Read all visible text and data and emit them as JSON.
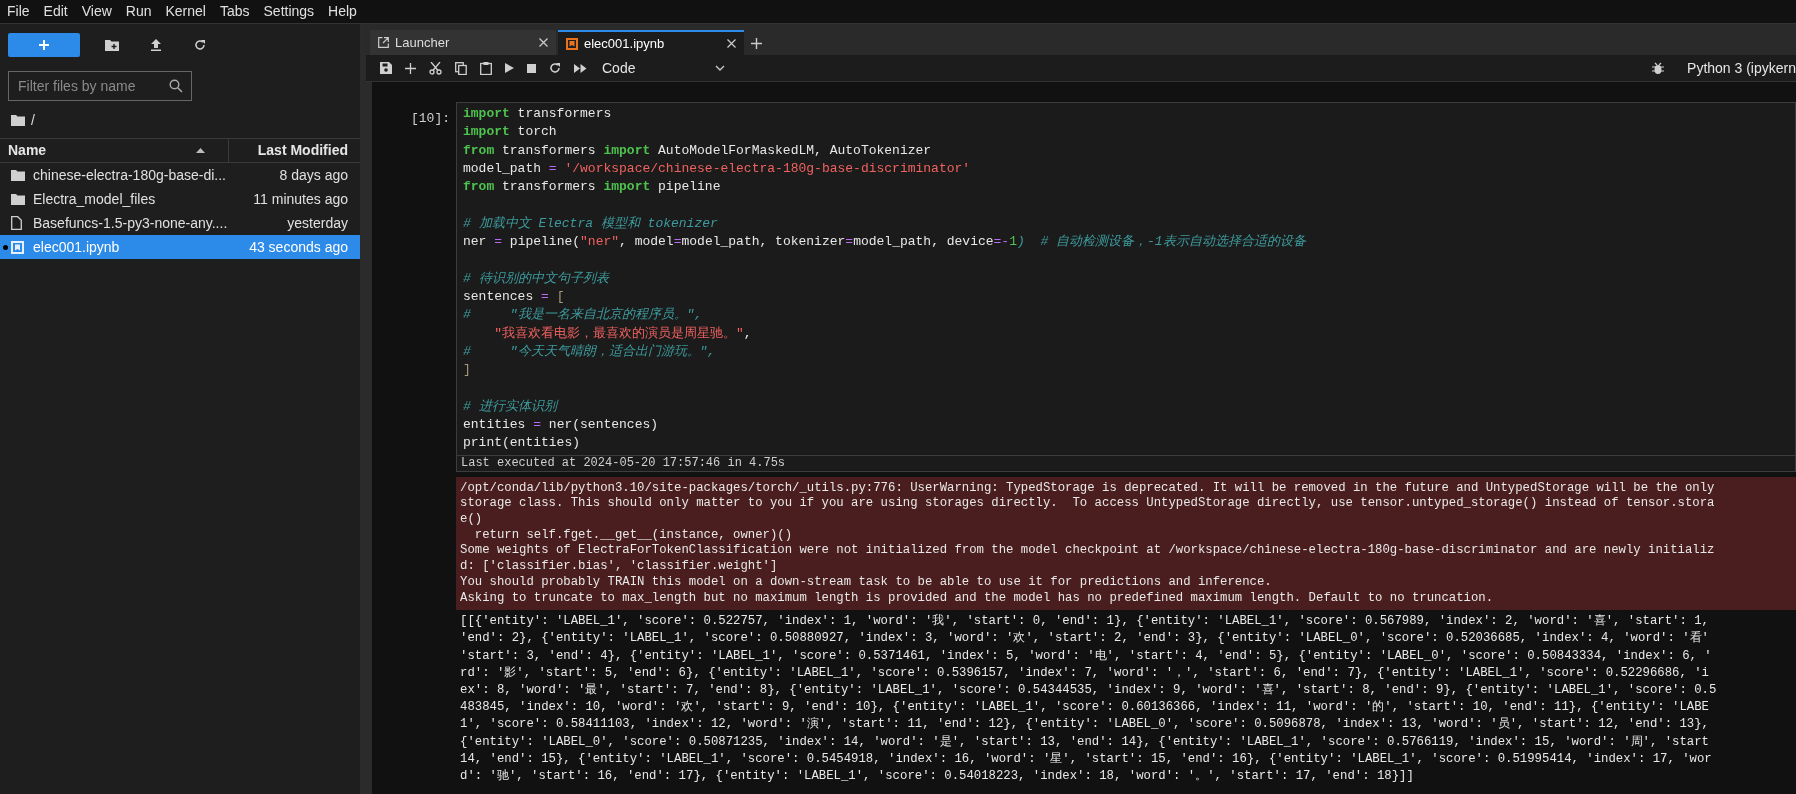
{
  "menu": [
    "File",
    "Edit",
    "View",
    "Run",
    "Kernel",
    "Tabs",
    "Settings",
    "Help"
  ],
  "file_browser": {
    "filter_placeholder": "Filter files by name",
    "path": "/",
    "columns": [
      "Name",
      "Last Modified"
    ],
    "files": [
      {
        "kind": "folder",
        "name": "chinese-electra-180g-base-di...",
        "modified": "8 days ago",
        "selected": false,
        "running": false
      },
      {
        "kind": "folder",
        "name": "Electra_model_files",
        "modified": "11 minutes ago",
        "selected": false,
        "running": false
      },
      {
        "kind": "file",
        "name": "Basefuncs-1.5-py3-none-any....",
        "modified": "yesterday",
        "selected": false,
        "running": false
      },
      {
        "kind": "notebook",
        "name": "elec001.ipynb",
        "modified": "43 seconds ago",
        "selected": true,
        "running": true
      }
    ]
  },
  "tabs": [
    {
      "kind": "launcher",
      "label": "Launcher",
      "selected": false
    },
    {
      "kind": "notebook",
      "label": "elec001.ipynb",
      "selected": true
    }
  ],
  "toolbar": {
    "cell_type": "Code",
    "kernel": "Python 3 (ipykern"
  },
  "cell": {
    "prompt": "[10]:",
    "blocks": [
      [
        [
          {
            "text": "import",
            "kind": "kw"
          },
          {
            "text": " transformers",
            "kind": "p"
          }
        ],
        [
          {
            "text": "import",
            "kind": "kw"
          },
          {
            "text": " torch",
            "kind": "p"
          }
        ],
        [
          {
            "text": "from",
            "kind": "kw"
          },
          {
            "text": " transformers ",
            "kind": "p"
          },
          {
            "text": "import",
            "kind": "kw"
          },
          {
            "text": " AutoModelForMaskedLM, AutoTokenizer",
            "kind": "p"
          }
        ],
        [
          {
            "text": "model_path ",
            "kind": "p"
          },
          {
            "text": "=",
            "kind": "op"
          },
          {
            "text": " '/workspace/chinese-electra-180g-base-discriminator'",
            "kind": "str"
          }
        ],
        [
          {
            "text": "from",
            "kind": "kw"
          },
          {
            "text": " transformers ",
            "kind": "p"
          },
          {
            "text": "import",
            "kind": "kw"
          },
          {
            "text": " pipeline",
            "kind": "p"
          }
        ]
      ],
      [
        [
          {
            "text": "# 加载中文 Electra 模型和 tokenizer",
            "kind": "com"
          }
        ],
        [
          {
            "text": "ner ",
            "kind": "p"
          },
          {
            "text": "=",
            "kind": "op"
          },
          {
            "text": " pipeline(",
            "kind": "p"
          },
          {
            "text": "\"ner\"",
            "kind": "str"
          },
          {
            "text": ", model",
            "kind": "p"
          },
          {
            "text": "=",
            "kind": "op"
          },
          {
            "text": "model_path, tokenizer",
            "kind": "p"
          },
          {
            "text": "=",
            "kind": "op"
          },
          {
            "text": "model_path, device",
            "kind": "p"
          },
          {
            "text": "=-",
            "kind": "op"
          },
          {
            "text": "1",
            "kind": "num"
          },
          {
            "text": ")  # 自动检测设备，-1表示自动选择合适的设备",
            "kind": "com"
          }
        ]
      ],
      [
        [
          {
            "text": "# 待识别的中文句子列表",
            "kind": "com"
          }
        ],
        [
          {
            "text": "sentences ",
            "kind": "p"
          },
          {
            "text": "=",
            "kind": "op"
          },
          {
            "text": " [",
            "kind": "br"
          }
        ],
        [
          {
            "text": "#     \"我是一名来自北京的程序员。\",",
            "kind": "com"
          }
        ],
        [
          {
            "text": "    \"我喜欢看电影，最喜欢的演员是周星驰。\"",
            "kind": "str"
          },
          {
            "text": ",",
            "kind": "p"
          }
        ],
        [
          {
            "text": "#     \"今天天气晴朗，适合出门游玩。\",",
            "kind": "com"
          }
        ],
        [
          {
            "text": "]",
            "kind": "br"
          }
        ]
      ],
      [
        [
          {
            "text": "# 进行实体识别",
            "kind": "com"
          }
        ],
        [
          {
            "text": "entities ",
            "kind": "p"
          },
          {
            "text": "=",
            "kind": "op"
          },
          {
            "text": " ner(sentences)",
            "kind": "p"
          }
        ],
        [
          {
            "text": "print(entities)",
            "kind": "p"
          }
        ]
      ]
    ],
    "last_executed": "Last executed at 2024-05-20 17:57:46 in 4.75s"
  },
  "stderr": [
    "/opt/conda/lib/python3.10/site-packages/torch/_utils.py:776: UserWarning: TypedStorage is deprecated. It will be removed in the future and UntypedStorage will be the only",
    "storage class. This should only matter to you if you are using storages directly.  To access UntypedStorage directly, use tensor.untyped_storage() instead of tensor.stora",
    "e()",
    "  return self.fget.__get__(instance, owner)()",
    "Some weights of ElectraForTokenClassification were not initialized from the model checkpoint at /workspace/chinese-electra-180g-base-discriminator and are newly initializ",
    "d: ['classifier.bias', 'classifier.weight']",
    "You should probably TRAIN this model on a down-stream task to be able to use it for predictions and inference.",
    "Asking to truncate to max_length but no maximum length is provided and the model has no predefined maximum length. Default to no truncation."
  ],
  "stdout": [
    "[[{'entity': 'LABEL_1', 'score': 0.522757, 'index': 1, 'word': '我', 'start': 0, 'end': 1}, {'entity': 'LABEL_1', 'score': 0.567989, 'index': 2, 'word': '喜', 'start': 1,",
    "'end': 2}, {'entity': 'LABEL_1', 'score': 0.50880927, 'index': 3, 'word': '欢', 'start': 2, 'end': 3}, {'entity': 'LABEL_0', 'score': 0.52036685, 'index': 4, 'word': '看'",
    "'start': 3, 'end': 4}, {'entity': 'LABEL_1', 'score': 0.5371461, 'index': 5, 'word': '电', 'start': 4, 'end': 5}, {'entity': 'LABEL_0', 'score': 0.50843334, 'index': 6, '",
    "rd': '影', 'start': 5, 'end': 6}, {'entity': 'LABEL_1', 'score': 0.5396157, 'index': 7, 'word': '，', 'start': 6, 'end': 7}, {'entity': 'LABEL_1', 'score': 0.52296686, 'i",
    "ex': 8, 'word': '最', 'start': 7, 'end': 8}, {'entity': 'LABEL_1', 'score': 0.54344535, 'index': 9, 'word': '喜', 'start': 8, 'end': 9}, {'entity': 'LABEL_1', 'score': 0.5",
    "483845, 'index': 10, 'word': '欢', 'start': 9, 'end': 10}, {'entity': 'LABEL_1', 'score': 0.60136366, 'index': 11, 'word': '的', 'start': 10, 'end': 11}, {'entity': 'LABE",
    "1', 'score': 0.58411103, 'index': 12, 'word': '演', 'start': 11, 'end': 12}, {'entity': 'LABEL_0', 'score': 0.5096878, 'index': 13, 'word': '员', 'start': 12, 'end': 13},",
    "{'entity': 'LABEL_0', 'score': 0.50871235, 'index': 14, 'word': '是', 'start': 13, 'end': 14}, {'entity': 'LABEL_1', 'score': 0.5766119, 'index': 15, 'word': '周', 'start",
    "14, 'end': 15}, {'entity': 'LABEL_1', 'score': 0.5454918, 'index': 16, 'word': '星', 'start': 15, 'end': 16}, {'entity': 'LABEL_1', 'score': 0.51995414, 'index': 17, 'wor",
    "d': '驰', 'start': 16, 'end': 17}, {'entity': 'LABEL_1', 'score': 0.54018223, 'index': 18, 'word': '。', 'start': 17, 'end': 18}]]"
  ]
}
